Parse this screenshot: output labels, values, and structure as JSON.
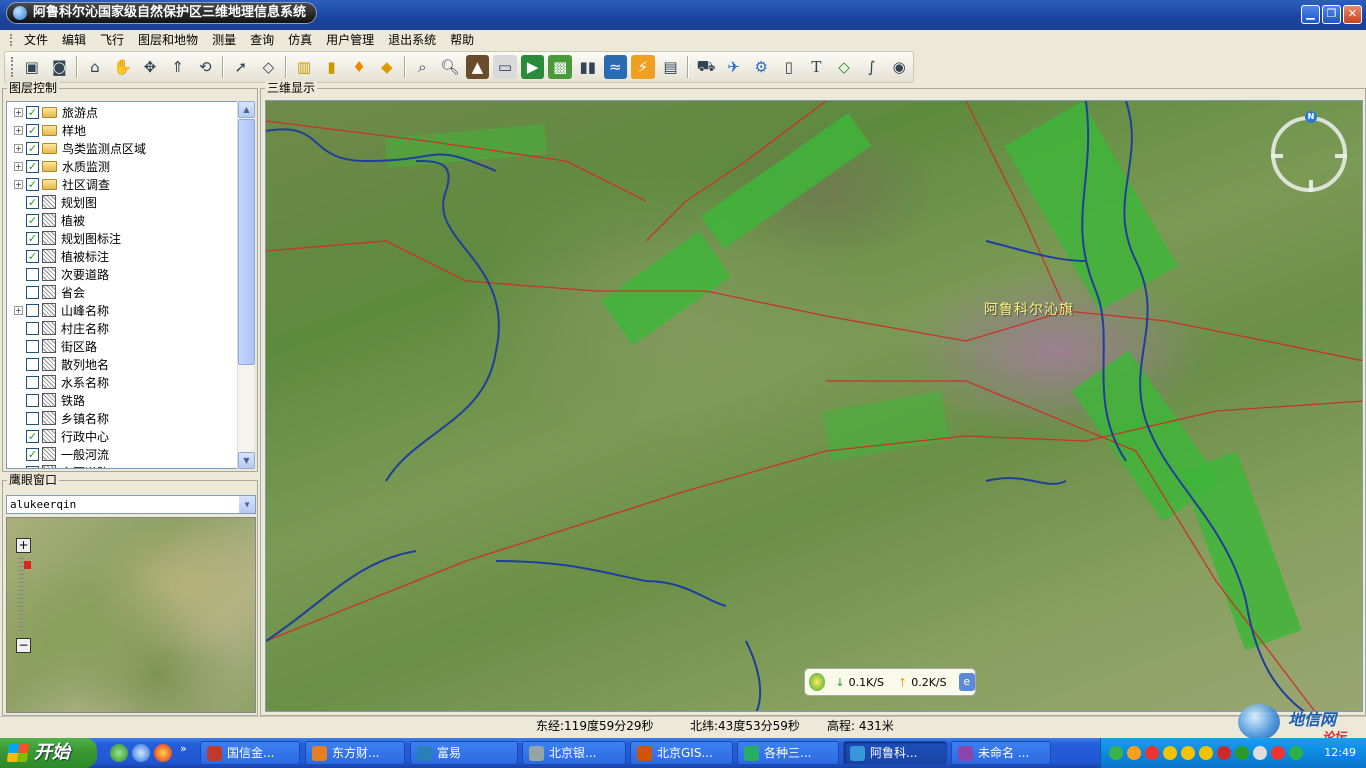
{
  "window": {
    "title": "阿鲁科尔沁国家级自然保护区三维地理信息系统",
    "controls": {
      "minimize": "▁",
      "restore": "❐",
      "close": "✕"
    }
  },
  "menu": [
    "文件",
    "编辑",
    "飞行",
    "图层和地物",
    "测量",
    "查询",
    "仿真",
    "用户管理",
    "退出系统",
    "帮助"
  ],
  "layer_panel": {
    "title": "图层控制",
    "layers": [
      {
        "label": "旅游点",
        "checked": true,
        "expandable": true,
        "icon": "folder-icon"
      },
      {
        "label": "样地",
        "checked": true,
        "expandable": true,
        "icon": "folder-icon"
      },
      {
        "label": "鸟类监测点区域",
        "checked": true,
        "expandable": true,
        "icon": "folder-icon"
      },
      {
        "label": "水质监测",
        "checked": true,
        "expandable": true,
        "icon": "folder-icon"
      },
      {
        "label": "社区调查",
        "checked": true,
        "expandable": true,
        "icon": "folder-icon"
      },
      {
        "label": "规划图",
        "checked": true,
        "expandable": false,
        "icon": "polygon-layer-icon"
      },
      {
        "label": "植被",
        "checked": true,
        "expandable": false,
        "icon": "polygon-layer-icon"
      },
      {
        "label": "规划图标注",
        "checked": true,
        "expandable": false,
        "icon": "point-layer-icon"
      },
      {
        "label": "植被标注",
        "checked": true,
        "expandable": false,
        "icon": "point-layer-icon"
      },
      {
        "label": "次要道路",
        "checked": false,
        "expandable": false,
        "icon": "line-layer-icon"
      },
      {
        "label": "省会",
        "checked": false,
        "expandable": false,
        "icon": "point-layer-icon"
      },
      {
        "label": "山峰名称",
        "checked": false,
        "expandable": true,
        "icon": "point-layer-icon"
      },
      {
        "label": "村庄名称",
        "checked": false,
        "expandable": false,
        "icon": "point-layer-icon"
      },
      {
        "label": "街区路",
        "checked": false,
        "expandable": false,
        "icon": "line-layer-icon"
      },
      {
        "label": "散列地名",
        "checked": false,
        "expandable": false,
        "icon": "point-layer-icon"
      },
      {
        "label": "水系名称",
        "checked": false,
        "expandable": false,
        "icon": "point-layer-icon"
      },
      {
        "label": "铁路",
        "checked": false,
        "expandable": false,
        "icon": "line-layer-icon"
      },
      {
        "label": "乡镇名称",
        "checked": false,
        "expandable": false,
        "icon": "point-layer-icon"
      },
      {
        "label": "行政中心",
        "checked": true,
        "expandable": false,
        "icon": "point-layer-icon"
      },
      {
        "label": "一般河流",
        "checked": true,
        "expandable": false,
        "icon": "line-layer-icon"
      },
      {
        "label": "主要道路",
        "checked": true,
        "expandable": false,
        "icon": "line-layer-icon"
      }
    ],
    "check_mark": "✓",
    "expand_mark": "+"
  },
  "eagle_panel": {
    "title": "鹰眼窗口",
    "select_value": "alukeerqin",
    "zoom_in": "+",
    "zoom_out": "−"
  },
  "view_panel": {
    "title": "三维显示",
    "place_label": "阿鲁科尔沁旗",
    "compass_north": "N",
    "network": {
      "down": "0.1K/S",
      "up": "0.2K/S",
      "down_arrow": "↓",
      "up_arrow": "↑"
    }
  },
  "statusbar": {
    "longitude": "东经:119度59分29秒",
    "latitude": "北纬:43度53分59秒",
    "elevation": "高程: 431米"
  },
  "watermark": {
    "text": "地信网",
    "sub": "论坛"
  },
  "taskbar": {
    "start": "开始",
    "tasks": [
      {
        "label": "国信金...",
        "color": "#c0392b"
      },
      {
        "label": "东方财...",
        "color": "#e67e22"
      },
      {
        "label": "富易",
        "color": "#2980b9"
      },
      {
        "label": "北京银...",
        "color": "#95a5a6"
      },
      {
        "label": "北京GIS...",
        "color": "#d35400"
      },
      {
        "label": "各种三...",
        "color": "#27ae60"
      },
      {
        "label": "阿鲁科...",
        "color": "#3498db",
        "active": true
      },
      {
        "label": "未命名 ...",
        "color": "#8e44ad"
      }
    ],
    "clock": "12:49"
  }
}
